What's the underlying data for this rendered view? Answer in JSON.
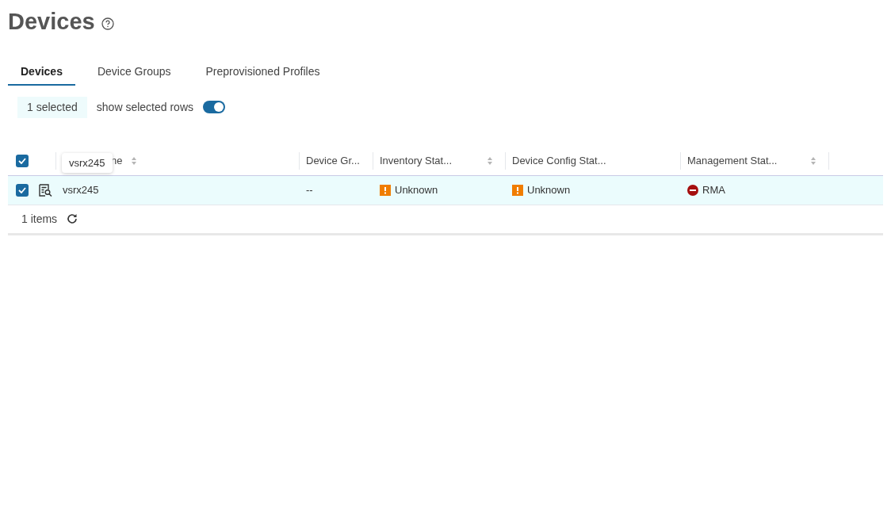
{
  "page": {
    "title": "Devices"
  },
  "tabs": [
    {
      "label": "Devices",
      "selected": true
    },
    {
      "label": "Device Groups",
      "selected": false
    },
    {
      "label": "Preprovisioned Profiles",
      "selected": false
    }
  ],
  "selection": {
    "count_label": "1 selected",
    "toggle_label": "show selected rows",
    "on": true
  },
  "table": {
    "all_checked": true,
    "columns": [
      {
        "label": "ne",
        "sortable": true
      },
      {
        "label": "Device Gr...",
        "sortable": false
      },
      {
        "label": "Inventory Stat...",
        "sortable": true
      },
      {
        "label": "Device Config Stat...",
        "sortable": false
      },
      {
        "label": "Management Stat...",
        "sortable": true
      }
    ],
    "rows": [
      {
        "checked": true,
        "selected": true,
        "name": "vsrx245",
        "device_group": "--",
        "inventory": {
          "kind": "warning",
          "label": "Unknown"
        },
        "config": {
          "kind": "warning",
          "label": "Unknown"
        },
        "management": {
          "kind": "blocked",
          "label": "RMA"
        }
      }
    ],
    "tooltip": "vsrx245",
    "footer": "1 items"
  }
}
